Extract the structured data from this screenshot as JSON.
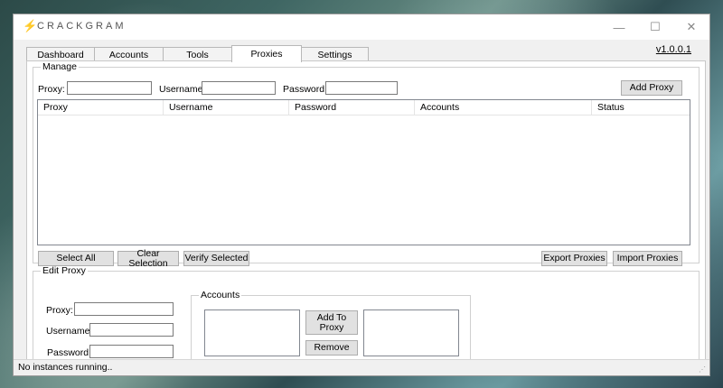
{
  "window": {
    "title": "CRACKGRAM",
    "icon": "lightning-icon",
    "controls": {
      "minimize": "—",
      "maximize": "☐",
      "close": "✕"
    }
  },
  "version": "v1.0.0.1",
  "tabs": [
    {
      "label": "Dashboard",
      "active": false
    },
    {
      "label": "Accounts",
      "active": false
    },
    {
      "label": "Tools",
      "active": false
    },
    {
      "label": "Proxies",
      "active": true
    },
    {
      "label": "Settings",
      "active": false
    }
  ],
  "manage": {
    "legend": "Manage",
    "proxy_label": "Proxy:",
    "proxy_value": "",
    "username_label": "Username:",
    "username_value": "",
    "password_label": "Password:",
    "password_value": "",
    "add_button": "Add Proxy",
    "columns": [
      "Proxy",
      "Username",
      "Password",
      "Accounts",
      "Status"
    ],
    "rows": [],
    "select_all": "Select All",
    "clear_selection": "Clear Selection",
    "verify_selected": "Verify Selected",
    "export": "Export Proxies",
    "import": "Import Proxies"
  },
  "edit": {
    "legend": "Edit Proxy",
    "proxy_label": "Proxy:",
    "username_label": "Username:",
    "password_label": "Password:",
    "accounts_legend": "Accounts",
    "add_to_proxy": "Add To Proxy",
    "remove": "Remove"
  },
  "status": {
    "text": "No instances running.."
  }
}
